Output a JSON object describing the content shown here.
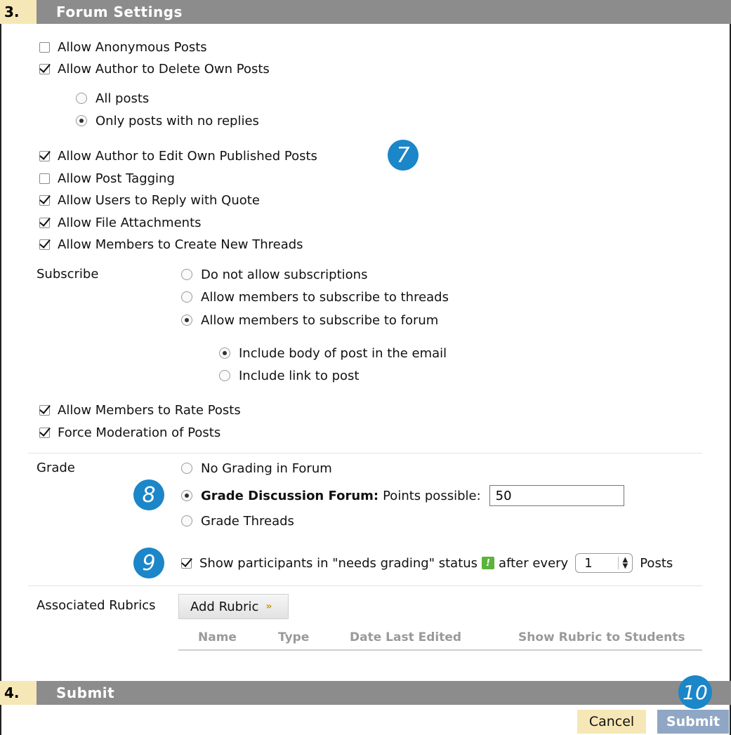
{
  "section3": {
    "number": "3.",
    "title": "Forum Settings"
  },
  "options": {
    "anonymous": "Allow Anonymous Posts",
    "delete_own": "Allow Author to Delete Own Posts",
    "all_posts": "All posts",
    "only_no_replies": "Only posts with no replies",
    "edit_own": "Allow Author to Edit Own Published Posts",
    "tagging": "Allow Post Tagging",
    "reply_quote": "Allow Users to Reply with Quote",
    "attachments": "Allow File Attachments",
    "new_threads": "Allow Members to Create New Threads",
    "rate_posts": "Allow Members to Rate Posts",
    "force_moderation": "Force Moderation of Posts"
  },
  "subscribe": {
    "label": "Subscribe",
    "none": "Do not allow subscriptions",
    "threads": "Allow members to subscribe to threads",
    "forum": "Allow members to subscribe to forum",
    "include_body": "Include body of post in the email",
    "include_link": "Include link to post"
  },
  "grade": {
    "label": "Grade",
    "no_grading": "No Grading in Forum",
    "grade_forum": "Grade Discussion Forum:",
    "points_label": "Points possible:",
    "points_value": "50",
    "grade_threads": "Grade Threads",
    "show_text": "Show participants in \"needs grading\" status",
    "after_every": "after every",
    "select_value": "1",
    "posts": "Posts",
    "warn_glyph": "!"
  },
  "rubrics": {
    "label": "Associated Rubrics",
    "add_button": "Add Rubric",
    "chevron": "»",
    "columns": [
      "Name",
      "Type",
      "Date Last Edited",
      "Show Rubric to Students"
    ]
  },
  "section4": {
    "number": "4.",
    "title": "Submit"
  },
  "buttons": {
    "cancel": "Cancel",
    "submit": "Submit"
  },
  "callouts": [
    "7",
    "8",
    "9",
    "10"
  ],
  "icons": {
    "warning": "needs-grading-icon",
    "select_arrows": "up-down-arrows-icon"
  },
  "colors": {
    "section_bar": "#8c8c8c",
    "section_number_bg": "#f6e7b6",
    "callout": "#1b86c8",
    "submit_bg": "#8fa7c4"
  }
}
